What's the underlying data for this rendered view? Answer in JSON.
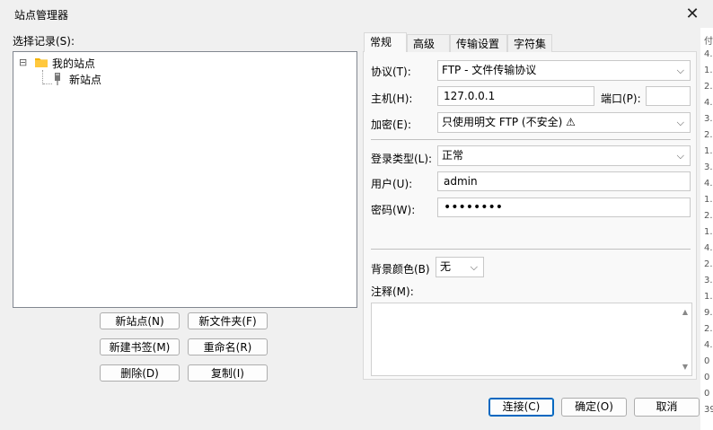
{
  "window": {
    "title": "站点管理器",
    "close_glyph": "✕"
  },
  "left": {
    "select_label": "选择记录(S):",
    "tree": {
      "root_toggle": "⊟",
      "root_label": "我的站点",
      "child_label": "新站点"
    },
    "buttons": {
      "new_site": "新站点(N)",
      "new_folder": "新文件夹(F)",
      "new_bookmark": "新建书签(M)",
      "rename": "重命名(R)",
      "delete": "删除(D)",
      "copy": "复制(I)"
    }
  },
  "tabs": [
    "常规",
    "高级",
    "传输设置",
    "字符集"
  ],
  "general": {
    "protocol_label": "协议(T):",
    "protocol_value": "FTP - 文件传输协议",
    "host_label": "主机(H):",
    "host_value": "127.0.0.1",
    "port_label": "端口(P):",
    "port_value": "",
    "encryption_label": "加密(E):",
    "encryption_value": "只使用明文 FTP (不安全) ⚠",
    "logon_label": "登录类型(L):",
    "logon_value": "正常",
    "user_label": "用户(U):",
    "user_value": "admin",
    "password_label": "密码(W):",
    "password_value": "••••••••",
    "bgcolor_label": "背景颜色(B)",
    "bgcolor_value": "无",
    "notes_label": "注释(M):"
  },
  "footer": {
    "connect": "连接(C)",
    "ok": "确定(O)",
    "cancel": "取消"
  },
  "background_fragments": [
    "付",
    "4.",
    "1.",
    "2.",
    "4.",
    "3.",
    "2.",
    "1.",
    "3.",
    "4.",
    "1.",
    "2.",
    "1.",
    "4.",
    "2.",
    "3.",
    "1.",
    "9.",
    "2.",
    "4.",
    "0",
    "0",
    "0",
    "39"
  ]
}
